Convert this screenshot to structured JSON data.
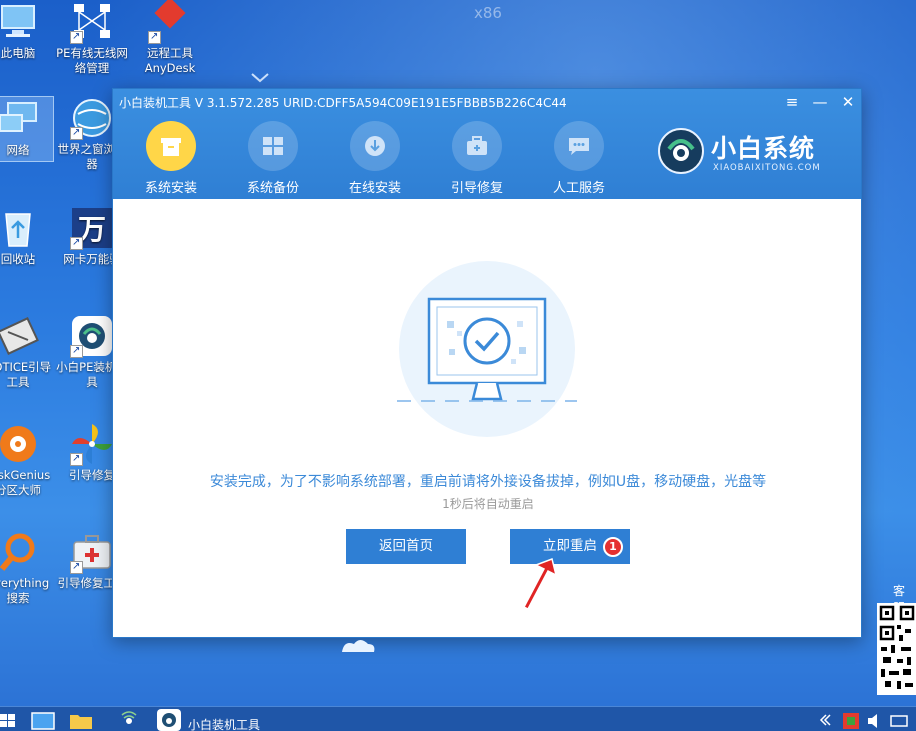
{
  "desktop": {
    "arch_label": "x86",
    "icons": [
      {
        "label": "此电脑",
        "name": "this-pc"
      },
      {
        "label": "PE有线无线网络管理",
        "name": "network-manager"
      },
      {
        "label": "远程工具AnyDesk",
        "name": "anydesk"
      },
      {
        "label": "网络",
        "name": "network"
      },
      {
        "label": "世界之窗浏览器",
        "name": "theworld-browser"
      },
      {
        "label": "回收站",
        "name": "recycle-bin"
      },
      {
        "label": "网卡万能驱",
        "name": "nic-driver"
      },
      {
        "label": "NOTICE引导工具",
        "name": "bootice"
      },
      {
        "label": "小白PE装机工具",
        "name": "xiaobai-pe"
      },
      {
        "label": "DiskGenius分区大师",
        "name": "diskgenius"
      },
      {
        "label": "引导修复",
        "name": "boot-repair-1"
      },
      {
        "label": "Everything搜索",
        "name": "everything"
      },
      {
        "label": "引导修复工具",
        "name": "boot-repair-2"
      }
    ],
    "kefu_label": "客服"
  },
  "window": {
    "title": "小白装机工具 V 3.1.572.285 URID:CDFF5A594C09E191E5FBBB5B226C4C44",
    "controls": {
      "menu": "≡",
      "minimize": "—",
      "close": "✕"
    },
    "tabs": [
      {
        "label": "系统安装",
        "active": true,
        "icon": "box-icon"
      },
      {
        "label": "系统备份",
        "active": false,
        "icon": "windows-icon"
      },
      {
        "label": "在线安装",
        "active": false,
        "icon": "download-icon"
      },
      {
        "label": "引导修复",
        "active": false,
        "icon": "toolbox-icon"
      },
      {
        "label": "人工服务",
        "active": false,
        "icon": "chat-icon"
      }
    ],
    "brand": {
      "name": "小白系统",
      "subtitle": "XIAOBAIXITONG.COM"
    },
    "message": "安装完成，为了不影响系统部署，重启前请将外接设备拔掉，例如U盘，移动硬盘，光盘等",
    "countdown": "1秒后将自动重启",
    "buttons": {
      "home": "返回首页",
      "restart": "立即重启"
    },
    "badge": "1"
  },
  "taskbar": {
    "app_label": "小白装机工具"
  },
  "colors": {
    "accent": "#2f7fd4",
    "active_tab": "#ffd648",
    "badge": "#e53030",
    "message": "#3c8ad8"
  }
}
